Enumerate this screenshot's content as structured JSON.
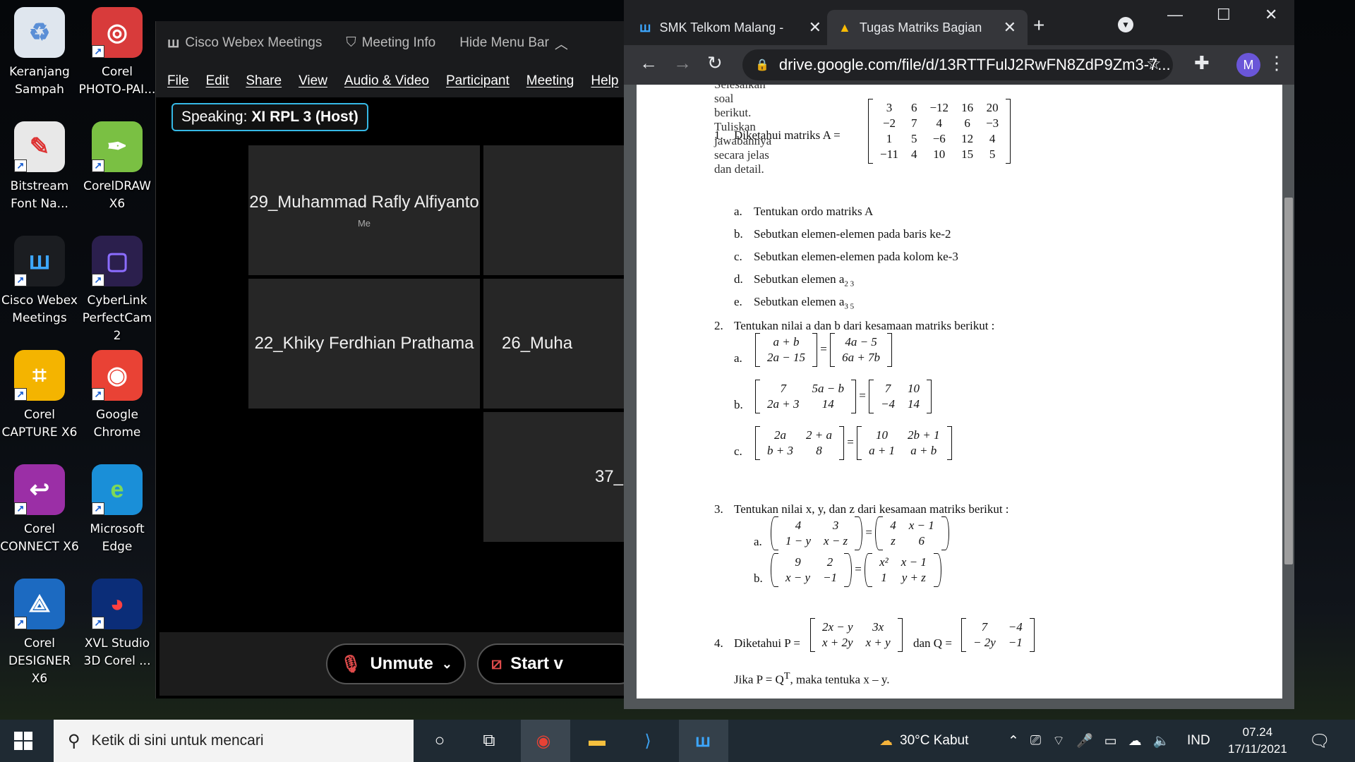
{
  "desktop_icons": [
    {
      "label": "Keranjang Sampah",
      "icon": "recycle-bin-icon"
    },
    {
      "label": "Corel PHOTO-PAI...",
      "icon": "corel-photo-paint-icon"
    },
    {
      "label": "Bitstream Font Na...",
      "icon": "bitstream-font-icon"
    },
    {
      "label": "CorelDRAW X6",
      "icon": "coreldraw-icon"
    },
    {
      "label": "Cisco Webex Meetings",
      "icon": "webex-icon"
    },
    {
      "label": "CyberLink PerfectCam 2",
      "icon": "perfectcam-icon"
    },
    {
      "label": "Corel CAPTURE X6",
      "icon": "corel-capture-icon"
    },
    {
      "label": "Google Chrome",
      "icon": "chrome-icon"
    },
    {
      "label": "Corel CONNECT X6",
      "icon": "corel-connect-icon"
    },
    {
      "label": "Microsoft Edge",
      "icon": "edge-icon"
    },
    {
      "label": "Corel DESIGNER X6",
      "icon": "corel-designer-icon"
    },
    {
      "label": "XVL Studio 3D Corel ...",
      "icon": "xvl-studio-icon"
    }
  ],
  "webex": {
    "title": "Cisco Webex Meetings",
    "meeting_info": "Meeting Info",
    "hide_menu": "Hide Menu Bar",
    "menu": [
      "File",
      "Edit",
      "Share",
      "View",
      "Audio & Video",
      "Participant",
      "Meeting",
      "Help"
    ],
    "speaking_prefix": "Speaking:",
    "speaking_name": "XI RPL 3 (Host)",
    "tiles": [
      {
        "name": "29_Muhammad Rafly Alfiyanto",
        "sub": "Me"
      },
      {
        "name": "22_Khiky Ferdhian Prathama",
        "sub": ""
      },
      {
        "name": "26_Muha",
        "sub": ""
      },
      {
        "name": "37_",
        "sub": ""
      }
    ],
    "unmute_label": "Unmute",
    "start_video_label": "Start v"
  },
  "chrome": {
    "tabs": [
      {
        "title": "SMK Telkom Malang -",
        "icon": "webex-tab-icon"
      },
      {
        "title": "Tugas Matriks Bagian",
        "icon": "google-drive-icon"
      }
    ],
    "url": "drive.google.com/file/d/13RTTFulJ2RwFN8ZdP9Zm3-7...",
    "avatar_letter": "M"
  },
  "document": {
    "cut_line": "Selesaikan soal berikut. Tuliskan jawabannya secara jelas dan detail.",
    "q1": {
      "number": "1.",
      "text": "Diketahui matriks  A =",
      "matrix": [
        [
          "3",
          "6",
          "−12",
          "16",
          "20"
        ],
        [
          "−2",
          "7",
          "4",
          "6",
          "−3"
        ],
        [
          "1",
          "5",
          "−6",
          "12",
          "4"
        ],
        [
          "−11",
          "4",
          "10",
          "15",
          "5"
        ]
      ],
      "items": [
        {
          "label": "a.",
          "text": "Tentukan ordo matriks A"
        },
        {
          "label": "b.",
          "text": "Sebutkan elemen-elemen pada baris ke-2"
        },
        {
          "label": "c.",
          "text": "Sebutkan elemen-elemen pada kolom ke-3"
        },
        {
          "label": "d.",
          "text": "Sebutkan elemen a",
          "sub": "2 3"
        },
        {
          "label": "e.",
          "text": "Sebutkan elemen a",
          "sub": "3 5"
        }
      ]
    },
    "q2": {
      "number": "2.",
      "text": "Tentukan nilai a dan b dari kesamaan matriks berikut :",
      "a": {
        "label": "a.",
        "left": [
          [
            "a + b"
          ],
          [
            "2a − 15"
          ]
        ],
        "right": [
          [
            "4a − 5"
          ],
          [
            "6a + 7b"
          ]
        ]
      },
      "b": {
        "label": "b.",
        "left": [
          [
            "7",
            "5a − b"
          ],
          [
            "2a + 3",
            "14"
          ]
        ],
        "right": [
          [
            "7",
            "10"
          ],
          [
            "−4",
            "14"
          ]
        ]
      },
      "c": {
        "label": "c.",
        "left": [
          [
            "2a",
            "2 + a"
          ],
          [
            "b + 3",
            "8"
          ]
        ],
        "right": [
          [
            "10",
            "2b + 1"
          ],
          [
            "a + 1",
            "a + b"
          ]
        ]
      }
    },
    "q3": {
      "number": "3.",
      "text": "Tentukan nilai x, y, dan z dari kesamaan matriks berikut :",
      "a": {
        "label": "a.",
        "left": [
          [
            "4",
            "3"
          ],
          [
            "1 − y",
            "x − z"
          ]
        ],
        "right": [
          [
            "4",
            "x − 1"
          ],
          [
            "z",
            "6"
          ]
        ]
      },
      "b": {
        "label": "b.",
        "left": [
          [
            "9",
            "2"
          ],
          [
            "x − y",
            "−1"
          ]
        ],
        "right": [
          [
            "x²",
            "x − 1"
          ],
          [
            "1",
            "y + z"
          ]
        ]
      }
    },
    "q4": {
      "number": "4.",
      "text_p": "Diketahui P =",
      "p": [
        [
          "2x − y",
          "3x"
        ],
        [
          "x + 2y",
          "x + y"
        ]
      ],
      "text_q": "dan Q =",
      "q": [
        [
          "7",
          "−4"
        ],
        [
          "− 2y",
          "−1"
        ]
      ],
      "line2": "Jika P = Q",
      "line2_sup": "T",
      "line2_end": ", maka tentuka x – y."
    }
  },
  "taskbar": {
    "search_placeholder": "Ketik di sini untuk mencari",
    "weather": "30°C  Kabut",
    "language": "IND",
    "time": "07.24",
    "date": "17/11/2021"
  }
}
